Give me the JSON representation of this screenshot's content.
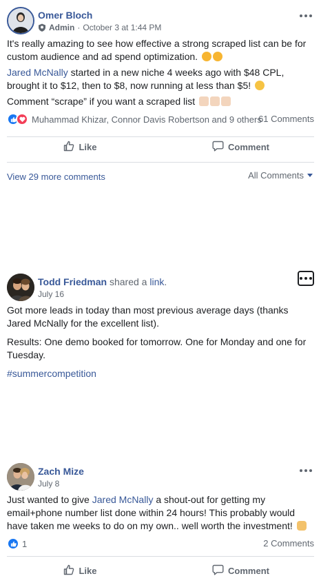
{
  "post1": {
    "author": "Omer Bloch",
    "role": "Admin",
    "separator": "·",
    "date": "October 3 at 1:44 PM",
    "line1": "It's really amazing to see how effective a strong scraped list can be for custom audience and ad spend optimization.",
    "mention": "Jared McNally",
    "line2_rest": " started in a new niche 4 weeks ago with $48 CPL, brought it to $12, then to $8, now running at less than $5!",
    "line3": "Comment “scrape” if you want a scraped list",
    "reactors": "Muhammad Khizar, Connor Davis Robertson and 9 others",
    "comments_count": "61 Comments",
    "like_label": "Like",
    "comment_label": "Comment",
    "view_more": "View 29 more comments",
    "sort_label": "All Comments"
  },
  "post2": {
    "author": "Todd Friedman",
    "shared_text": " shared a ",
    "link_word": "link",
    "period": ".",
    "date": "July 16",
    "para1": "Got more leads in today than most previous average days (thanks Jared McNally for the excellent list).",
    "para2": "Results: One demo booked for tomorrow. One for Monday and one for Tuesday.",
    "hashtag": "#summercompetition"
  },
  "post3": {
    "author": "Zach Mize",
    "date": "July 8",
    "text_before": "Just wanted to give ",
    "mention": "Jared McNally",
    "text_after": " a shout-out for getting my email+phone number list done within 24 hours! This probably would have taken me weeks to do on my own.. well worth the investment!",
    "reaction_count": "1",
    "comments_count": "2 Comments",
    "like_label": "Like",
    "comment_label": "Comment"
  },
  "icons": {
    "more": "more-options-icon",
    "like": "thumbs-up-icon",
    "comment": "speech-bubble-icon",
    "globe": "group-admin-icon"
  },
  "colors": {
    "link": "#385898",
    "like_blue": "#1877f2",
    "love_red": "#f33e58",
    "muted": "#606770"
  }
}
